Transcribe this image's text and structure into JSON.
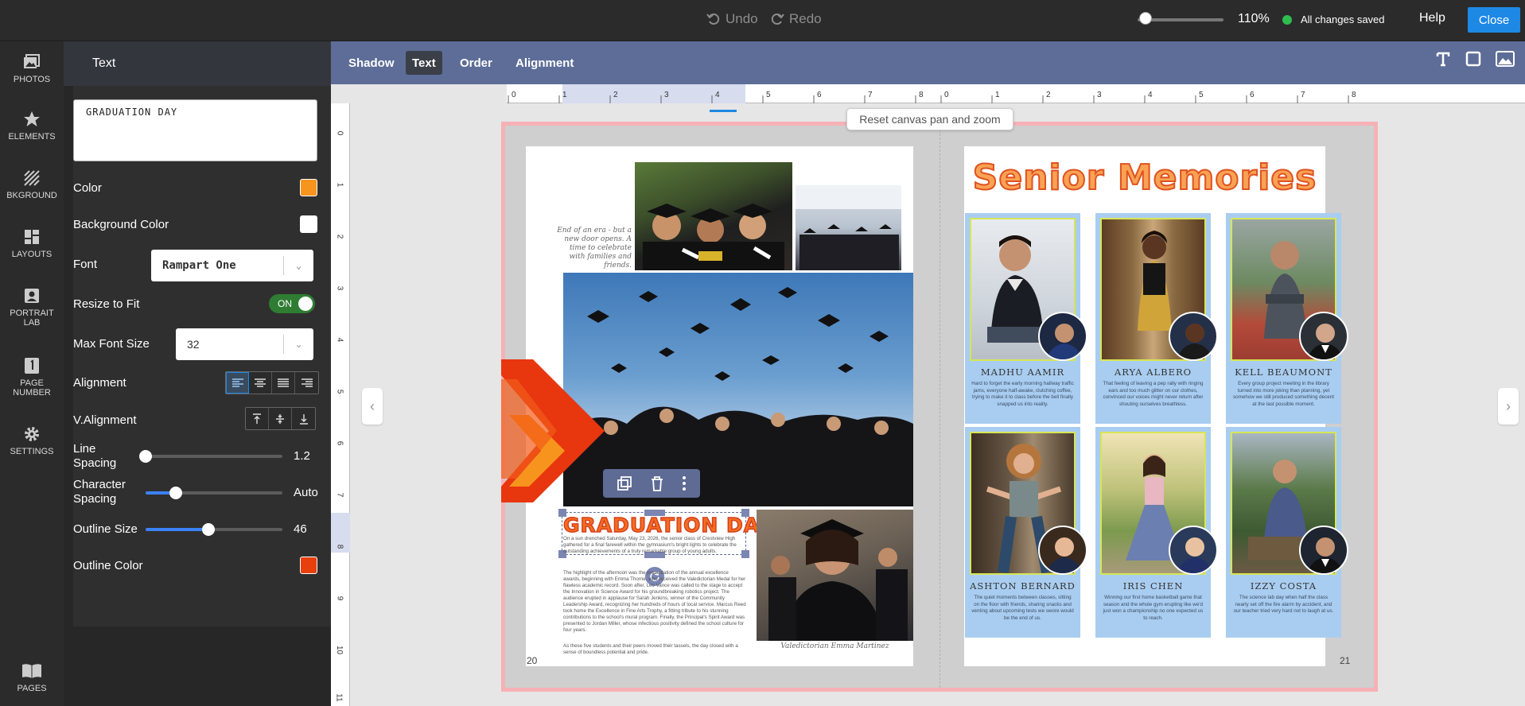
{
  "topbar": {
    "undo": "Undo",
    "redo": "Redo",
    "zoom": "110%",
    "zoom_level": 0.05,
    "save_status": "All changes saved",
    "help": "Help",
    "close": "Close"
  },
  "rail": [
    {
      "label": "PHOTOS",
      "icon": "photos-icon"
    },
    {
      "label": "ELEMENTS",
      "icon": "star-icon"
    },
    {
      "label": "BKGROUND",
      "icon": "background-icon"
    },
    {
      "label": "LAYOUTS",
      "icon": "layouts-icon"
    },
    {
      "label": "PORTRAIT LAB",
      "icon": "portrait-icon"
    },
    {
      "label": "PAGE NUMBER",
      "icon": "page-number-icon"
    },
    {
      "label": "SETTINGS",
      "icon": "gear-icon"
    },
    {
      "label": "PAGES",
      "icon": "book-icon"
    }
  ],
  "panel": {
    "title": "Text",
    "text_value": "GRADUATION DAY",
    "color_label": "Color",
    "color": "#f7941d",
    "bg_color_label": "Background Color",
    "bg_color": "#ffffff",
    "font_label": "Font",
    "font_value": "Rampart One",
    "resize_label": "Resize to Fit",
    "resize_state": "ON",
    "max_font_label": "Max Font Size",
    "max_font_value": "32",
    "alignment_label": "Alignment",
    "valign_label": "V.Alignment",
    "line_spacing_label": "Line Spacing",
    "line_spacing_value": "1.2",
    "line_spacing_level": 0.0,
    "char_spacing_label": "Character Spacing",
    "char_spacing_value": "Auto",
    "char_spacing_level": 0.22,
    "outline_size_label": "Outline Size",
    "outline_size_value": "46",
    "outline_size_level": 0.46,
    "outline_color_label": "Outline Color",
    "outline_color": "#e8400c"
  },
  "toolbar": {
    "tabs": [
      "Shadow",
      "Text",
      "Order",
      "Alignment"
    ],
    "active": "Text"
  },
  "canvas": {
    "reset_label": "Reset canvas pan and zoom"
  },
  "ruler": {
    "h_ticks_left": [
      "0",
      "1",
      "2",
      "3",
      "4",
      "5",
      "6",
      "7",
      "8"
    ],
    "h_ticks_right": [
      "0",
      "1",
      "2",
      "3",
      "4",
      "5",
      "6",
      "7",
      "8"
    ],
    "v_ticks": [
      "0",
      "1",
      "2",
      "3",
      "4",
      "5",
      "6",
      "7",
      "8",
      "9",
      "10",
      "11"
    ]
  },
  "left_page": {
    "page_number": "20",
    "caption_top": "End of an era - but a new door opens. A time to celebrate with families and friends.",
    "title": "GRADUATION DAY",
    "para1": "On a sun drenched Saturday, May 23, 2026, the senior class of Crestview High gathered for a final farewell within the gymnasium's bright lights to celebrate the outstanding achievements of a truly remarkable group of young adults.",
    "para2": "The highlight of the afternoon was the presentation of the annual excellence awards, beginning with Emma Thorne, who received the Valedictorian Medal for her flawless academic record. Soon after, Leo Vance was called to the stage to accept the Innovation in Science Award for his groundbreaking robotics project. The audience erupted in applause for Sarah Jenkins, winner of the Community Leadership Award, recognizing her hundreds of hours of local service. Marcus Reed took home the Excellence in Fine Arts Trophy, a fitting tribute to his stunning contributions to the school's mural program. Finally, the Principal's Spirit Award was presented to Jordan Miller, whose infectious positivity defined the school culture for four years.",
    "para3": "As these five students and their peers moved their tassels, the day closed with a sense of boundless potential and pride.",
    "caption_bottom": "Valedictorian Emma Martinez"
  },
  "right_page": {
    "page_number": "21",
    "title": "Senior Memories",
    "students": [
      {
        "name": "Madhu Aamir",
        "bio": "Hard to forget the early morning hallway traffic jams, everyone half-awake, clutching coffee, trying to make it to class before the bell finally snapped us into reality."
      },
      {
        "name": "Arya Albero",
        "bio": "That feeling of leaving a pep rally with ringing ears and too much glitter on our clothes, convinced our voices might never return after shouting ourselves breathless."
      },
      {
        "name": "Kell Beaumont",
        "bio": "Every group project meeting in the library turned into more joking than planning, yet somehow we still produced something decent at the last possible moment."
      },
      {
        "name": "Ashton Bernard",
        "bio": "The quiet moments between classes, sitting on the floor with friends, sharing snacks and venting about upcoming tests we swore would be the end of us."
      },
      {
        "name": "Iris Chen",
        "bio": "Winning our first home basketball game that season and the whole gym erupting like we'd just won a championship no one expected us to reach."
      },
      {
        "name": "Izzy Costa",
        "bio": "The science lab day when half the class nearly set off the fire alarm by accident, and our teacher tried very hard not to laugh at us."
      }
    ]
  }
}
